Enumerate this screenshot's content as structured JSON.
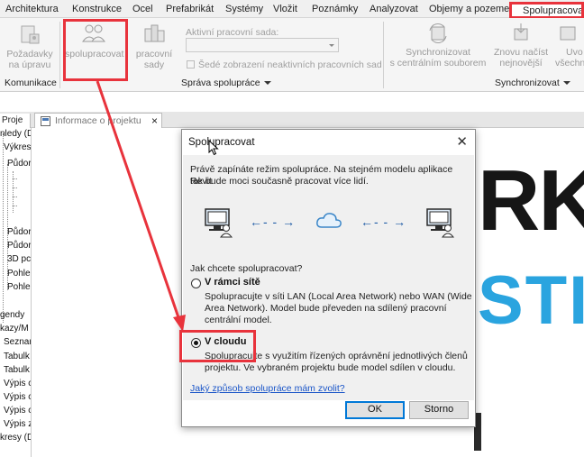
{
  "menu": {
    "tabs": [
      "Architektura",
      "Konstrukce",
      "Ocel",
      "Prefabrikát",
      "Systémy",
      "Vložit",
      "Poznámky",
      "Analyzovat",
      "Objemy a pozemek"
    ],
    "active_tab": "Spolupracovat"
  },
  "ribbon": {
    "communication": {
      "button_line1": "Požadavky",
      "button_line2": "na úpravu",
      "group_label": "Komunikace"
    },
    "manage": {
      "collaborate_label": "spolupracovat",
      "worksets_label": "pracovní sady",
      "active_workset_label": "Aktivní pracovní sada:",
      "gray_inactive_label": "Šedé zobrazení neaktivních pracovních sad",
      "group_label": "Správa spolupráce"
    },
    "sync": {
      "sync_line1": "Synchronizovat",
      "sync_line2": "s centrálním souborem",
      "reload_line1": "Znovu načíst",
      "reload_line2": "nejnovější",
      "relinquish_line1": "Uvo",
      "relinquish_line2": "všechny",
      "group_label": "Synchronizovat"
    }
  },
  "browser": {
    "tab_label": "Proje",
    "items": [
      "nledy (D",
      "Výkres",
      "Půdor",
      "Půdor",
      "Půdor",
      "3D pc",
      "Pohle",
      "Pohle",
      "gendy",
      "kazy/M",
      "Seznar",
      "Tabulk",
      "Tabulk",
      "Výpis c",
      "Výpis c",
      "Výpis c",
      "Výpis z",
      "kresy (D"
    ]
  },
  "document_tab": {
    "label": "Informace o projektu",
    "close": "×"
  },
  "canvas": {
    "logo_top": "RK",
    "logo_bottom": "STI"
  },
  "dialog": {
    "title": "Spolupracovat",
    "close": "✕",
    "intro_line1": "Právě zapínáte režim spolupráce. Na stejném modelu aplikace Revit",
    "intro_line2": "tak bude moci současně pracovat více lidí.",
    "arrow_left": "←- - →",
    "arrow_right": "←- - →",
    "question": "Jak chcete spolupracovat?",
    "option_network": {
      "label": "V rámci sítě",
      "desc_line1": "Spolupracujte v síti LAN (Local Area Network) nebo WAN (Wide",
      "desc_line2": "Area Network). Model bude převeden na sdílený pracovní",
      "desc_line3": "centrální model.",
      "selected": false
    },
    "option_cloud": {
      "label": "V cloudu",
      "desc_line1": "Spolupracujte s využitím řízených oprávnění jednotlivých členů",
      "desc_line2": "projektu. Ve vybraném projektu bude model sdílen v cloudu.",
      "selected": true
    },
    "help_link": "Jaký způsob spolupráce mám zvolit?",
    "ok": "OK",
    "cancel": "Storno"
  },
  "colors": {
    "highlight_red": "#e8333c",
    "link_blue": "#1a55c8",
    "brand_blue": "#2aa4df"
  }
}
